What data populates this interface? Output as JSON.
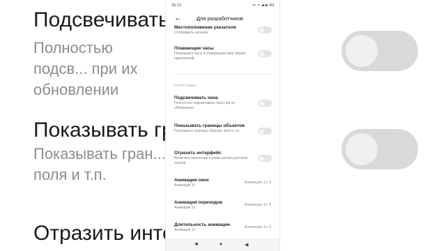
{
  "background": {
    "items": [
      {
        "title": "Подсвечивать",
        "sub": "Полностью подсв...      при их обновлении"
      },
      {
        "title": "Показывать гр...    ъектов",
        "sub": "Показывать гран...     поля и т.п."
      },
      {
        "title": "Отразить инте...",
        "sub": ""
      }
    ]
  },
  "status": {
    "time": "15:13",
    "icons": "▪▪ ◓ ▰▰ 83"
  },
  "appbar": {
    "back_icon": "arrow-left-icon",
    "title": "Для разработчиков"
  },
  "settings": [
    {
      "title": "Местоположение указателя",
      "sub": "Отображать касания",
      "control": "toggle"
    },
    {
      "title": "Плавающие часы",
      "sub": "Показывать часы в плавающем окне поверх приложений.",
      "control": "toggle"
    },
    {
      "title": "Подсвечивать окна",
      "sub": "Полностью подсвечивать окна при их обновлении",
      "control": "toggle"
    },
    {
      "title": "Показывать границы объектов",
      "sub": "Показывать границы обрезки, поля и т.п.",
      "control": "toggle"
    },
    {
      "title": "Отразить интерфейс",
      "sub": "Включить написание справа налево для всех языков",
      "control": "toggle"
    },
    {
      "title": "Анимация окон",
      "sub": "Анимация 1x",
      "control": "value",
      "value": "Анимация 1x"
    },
    {
      "title": "Анимация переходов",
      "sub": "Анимация 1x",
      "control": "value",
      "value": "Анимация 1x"
    },
    {
      "title": "Длительность анимации",
      "sub": "Анимация 1x",
      "control": "value",
      "value": "Анимация 1x"
    }
  ],
  "section_label": "ОТРИСОВКА",
  "navbar": {
    "recents": "■",
    "home": "●",
    "back": "◀"
  }
}
